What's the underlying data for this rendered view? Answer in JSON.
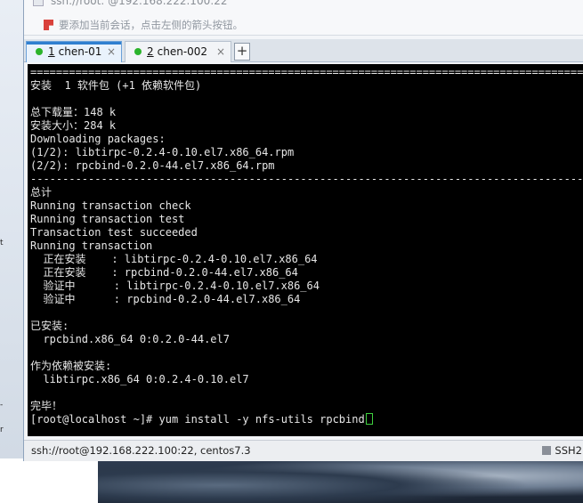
{
  "session": {
    "address": "ssh://root:        @192.168.222.100:22",
    "hint": "要添加当前会话，点击左侧的箭头按钮。"
  },
  "tabs": [
    {
      "number": "1",
      "label": "chen-01",
      "active": true
    },
    {
      "number": "2",
      "label": "chen-002",
      "active": false
    }
  ],
  "tab_add_label": "+",
  "tab_close_label": "×",
  "terminal": {
    "lines": [
      "================================================================================================",
      "安装  1 软件包 (+1 依赖软件包)",
      "",
      "总下载量：148 k",
      "安装大小：284 k",
      "Downloading packages:",
      "(1/2): libtirpc-0.2.4-0.10.el7.x86_64.rpm",
      "(2/2): rpcbind-0.2.0-44.el7.x86_64.rpm",
      "------------------------------------------------------------------------------------------------",
      "总计",
      "Running transaction check",
      "Running transaction test",
      "Transaction test succeeded",
      "Running transaction",
      "  正在安装    : libtirpc-0.2.4-0.10.el7.x86_64",
      "  正在安装    : rpcbind-0.2.0-44.el7.x86_64",
      "  验证中      : libtirpc-0.2.4-0.10.el7.x86_64",
      "  验证中      : rpcbind-0.2.0-44.el7.x86_64",
      "",
      "已安装:",
      "  rpcbind.x86_64 0:0.2.0-44.el7",
      "",
      "作为依赖被安装:",
      "  libtirpc.x86_64 0:0.2.4-0.10.el7",
      "",
      "完毕！"
    ],
    "prompt": "[root@localhost ~]# ",
    "command": "yum install -y nfs-utils rpcbind"
  },
  "status": {
    "connection": "ssh://root@192.168.222.100:22, centos7.3",
    "protocol": "SSH2"
  },
  "colors": {
    "terminal_bg": "#000000",
    "terminal_fg": "#e6e6e6",
    "cursor": "#3fd03f",
    "tab_dot": "#2bb32b",
    "tab_active_accent": "#2f7fd0"
  },
  "icons": {
    "hint": "session-arrow-icon",
    "status": "status-square-icon"
  }
}
